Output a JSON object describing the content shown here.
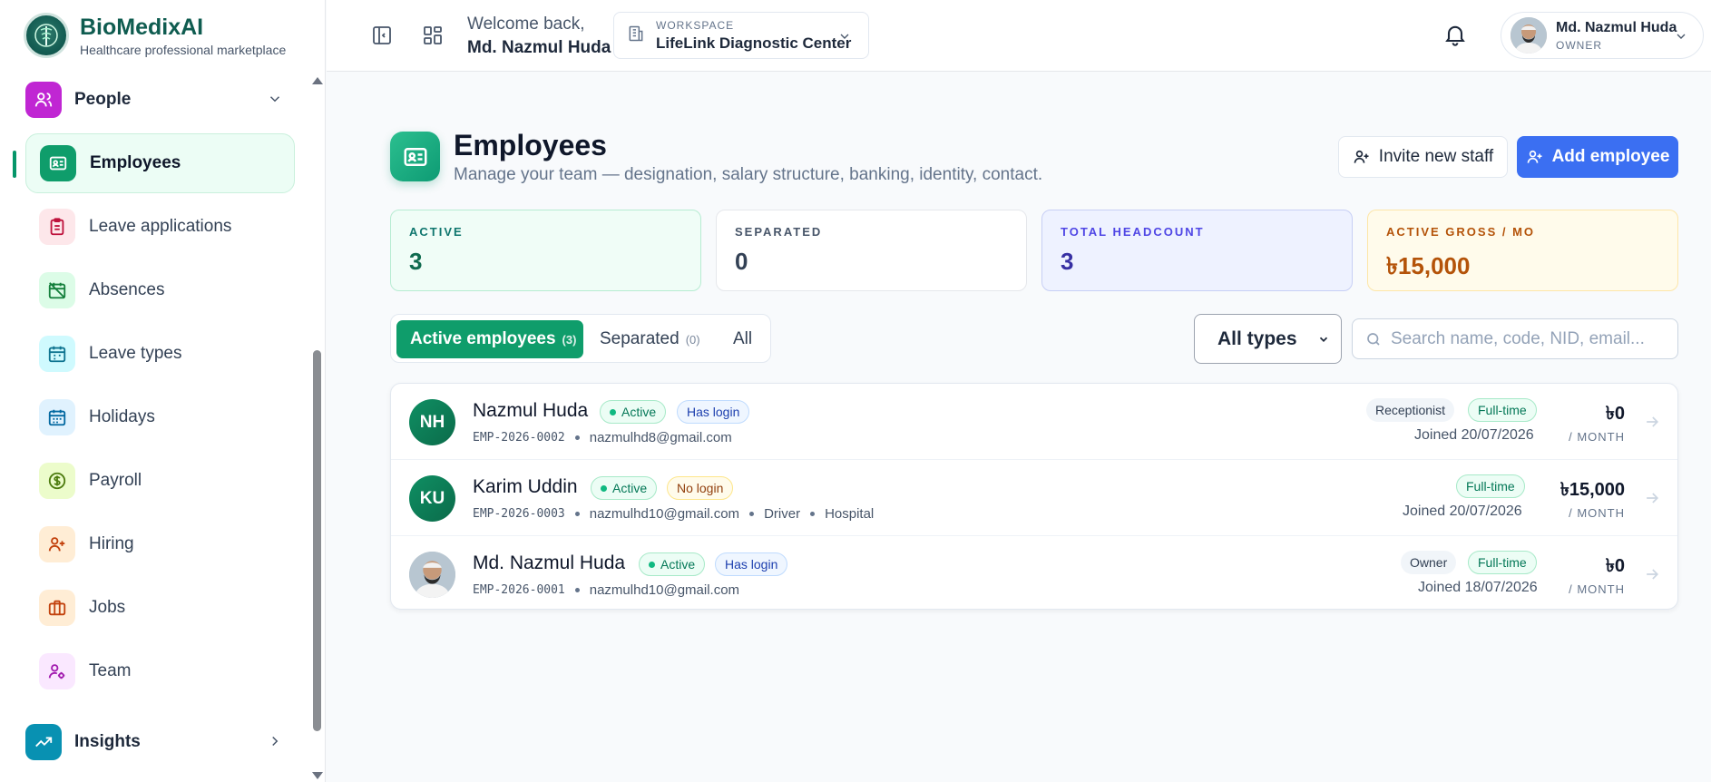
{
  "brand": {
    "name": "BioMedixAI",
    "tagline": "Healthcare professional marketplace"
  },
  "sidebar": {
    "groups": [
      {
        "label": "People",
        "icon": "people-icon",
        "color": "#c026d3"
      },
      {
        "label": "Insights",
        "icon": "trending-up-icon",
        "color": "#0891b2"
      }
    ],
    "items": [
      {
        "label": "Employees",
        "icon": "id-card-icon",
        "active": true
      },
      {
        "label": "Leave applications",
        "icon": "clipboard-icon"
      },
      {
        "label": "Absences",
        "icon": "calendar-off-icon"
      },
      {
        "label": "Leave types",
        "icon": "calendar-icon"
      },
      {
        "label": "Holidays",
        "icon": "calendar-days-icon"
      },
      {
        "label": "Payroll",
        "icon": "dollar-circle-icon"
      },
      {
        "label": "Hiring",
        "icon": "user-plus-icon"
      },
      {
        "label": "Jobs",
        "icon": "briefcase-icon"
      },
      {
        "label": "Team",
        "icon": "user-gear-icon"
      }
    ]
  },
  "topbar": {
    "welcome_line": "Welcome back,",
    "welcome_name": "Md. Nazmul Huda",
    "workspace_kicker": "WORKSPACE",
    "workspace_name": "LifeLink Diagnostic Center",
    "user_name": "Md. Nazmul Huda",
    "user_role": "OWNER"
  },
  "page": {
    "title": "Employees",
    "subtitle": "Manage your team — designation, salary structure, banking, identity, contact.",
    "invite_label": "Invite new staff",
    "add_label": "Add employee"
  },
  "stats": [
    {
      "label": "ACTIVE",
      "value": "3"
    },
    {
      "label": "SEPARATED",
      "value": "0"
    },
    {
      "label": "TOTAL HEADCOUNT",
      "value": "3"
    },
    {
      "label": "ACTIVE GROSS / MO",
      "value": "৳15,000"
    }
  ],
  "filters": {
    "tabs": [
      {
        "label": "Active employees",
        "count": "(3)"
      },
      {
        "label": "Separated",
        "count": "(0)"
      },
      {
        "label": "All",
        "count": ""
      }
    ],
    "type_selected": "All types",
    "search_placeholder": "Search name, code, NID, email..."
  },
  "employees": [
    {
      "initials": "NH",
      "name": "Nazmul Huda",
      "status": "Active",
      "login": "Has login",
      "code": "EMP-2026-0002",
      "email": "nazmulhd8@gmail.com",
      "role": "Receptionist",
      "type": "Full-time",
      "joined": "Joined 20/07/2026",
      "salary": "৳0",
      "per": "/ MONTH"
    },
    {
      "initials": "KU",
      "name": "Karim Uddin",
      "status": "Active",
      "login": "No login",
      "code": "EMP-2026-0003",
      "email": "nazmulhd10@gmail.com",
      "designation": "Driver",
      "department": "Hospital",
      "type": "Full-time",
      "joined": "Joined 20/07/2026",
      "salary": "৳15,000",
      "per": "/ MONTH"
    },
    {
      "initials": "",
      "name": "Md. Nazmul Huda",
      "status": "Active",
      "login": "Has login",
      "code": "EMP-2026-0001",
      "email": "nazmulhd10@gmail.com",
      "role": "Owner",
      "type": "Full-time",
      "joined": "Joined 18/07/2026",
      "salary": "৳0",
      "per": "/ MONTH"
    }
  ]
}
